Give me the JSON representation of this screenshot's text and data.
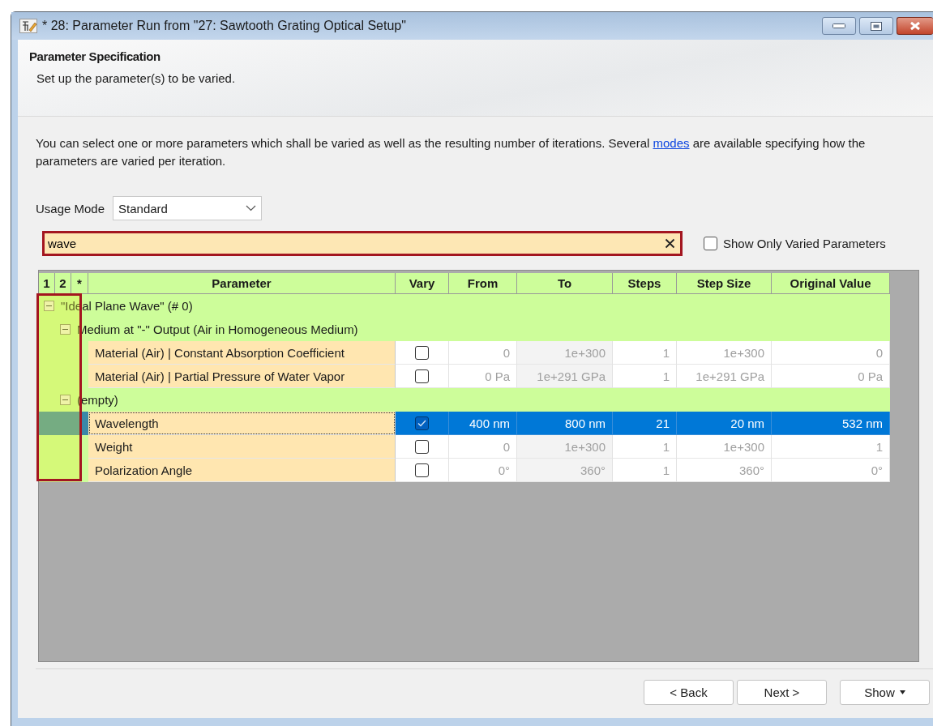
{
  "window": {
    "title": "* 28: Parameter Run from \"27: Sawtooth Grating Optical Setup\""
  },
  "header": {
    "title": "Parameter Specification",
    "subtitle": "Set up the parameter(s) to be varied."
  },
  "intro": {
    "text_before": "You can select one or more parameters which shall be varied as well as the resulting number of iterations. Several ",
    "link": "modes",
    "text_after": " are available specifying how the parameters are varied per iteration."
  },
  "usage_mode": {
    "label": "Usage Mode",
    "value": "Standard"
  },
  "search": {
    "value": "wave",
    "highlighted": true
  },
  "show_only_varied": {
    "label": "Show Only Varied Parameters",
    "checked": false
  },
  "table": {
    "columns": [
      "1",
      "2",
      "*",
      "Parameter",
      "Vary",
      "From",
      "To",
      "Steps",
      "Step Size",
      "Original Value"
    ],
    "highlight_tree_columns": true,
    "tree": [
      {
        "kind": "group",
        "label": "\"Ideal Plane Wave\" (# 0)",
        "expanded": true,
        "children": [
          {
            "kind": "group",
            "label": "Medium at \"-\" Output (Air in Homogeneous Medium)",
            "expanded": true,
            "children": [
              {
                "kind": "parameter",
                "name": "Material (Air) | Constant Absorption Coefficient",
                "vary": false,
                "selected": false,
                "from": "0",
                "to": "1e+300",
                "steps": "1",
                "step_size": "1e+300",
                "original_value": "0"
              },
              {
                "kind": "parameter",
                "name": "Material (Air) | Partial Pressure of Water Vapor",
                "vary": false,
                "selected": false,
                "from": "0 Pa",
                "to": "1e+291 GPa",
                "steps": "1",
                "step_size": "1e+291 GPa",
                "original_value": "0 Pa"
              }
            ]
          },
          {
            "kind": "group",
            "label": "(empty)",
            "expanded": true,
            "children": [
              {
                "kind": "parameter",
                "name": "Wavelength",
                "vary": true,
                "selected": true,
                "from": "400 nm",
                "to": "800 nm",
                "steps": "21",
                "step_size": "20 nm",
                "original_value": "532 nm"
              },
              {
                "kind": "parameter",
                "name": "Weight",
                "vary": false,
                "selected": false,
                "from": "0",
                "to": "1e+300",
                "steps": "1",
                "step_size": "1e+300",
                "original_value": "1"
              },
              {
                "kind": "parameter",
                "name": "Polarization Angle",
                "vary": false,
                "selected": false,
                "from": "0°",
                "to": "360°",
                "steps": "1",
                "step_size": "360°",
                "original_value": "0°"
              }
            ]
          }
        ]
      }
    ]
  },
  "buttons": [
    {
      "label": "< Back",
      "dropdown": false
    },
    {
      "label": "Next >",
      "dropdown": false
    },
    {
      "label": "Show",
      "dropdown": true
    }
  ]
}
